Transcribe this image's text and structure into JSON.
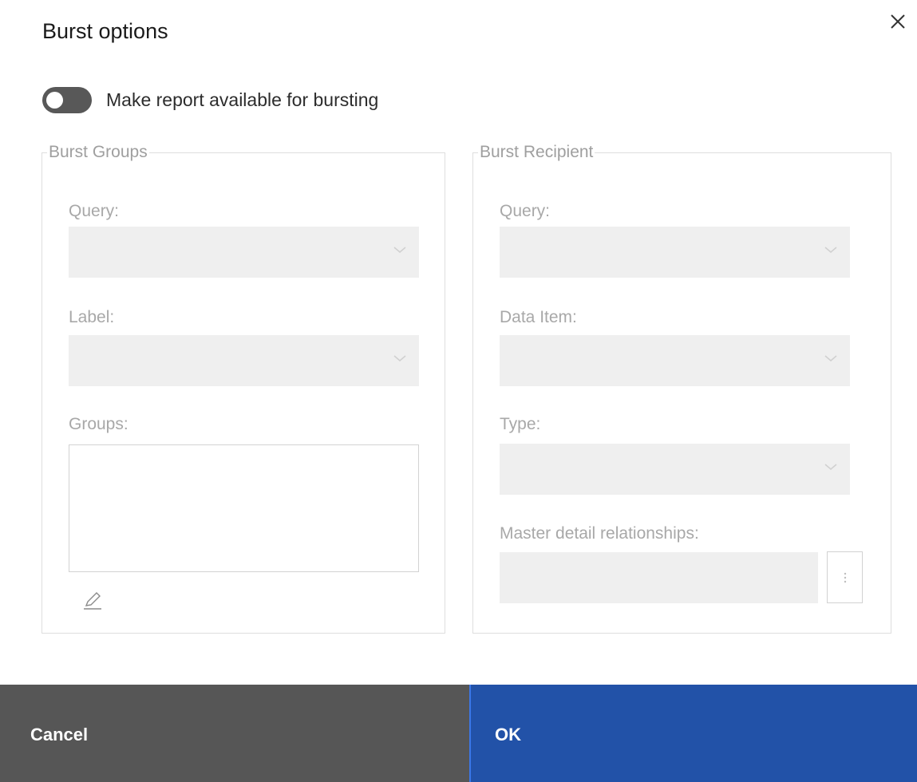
{
  "dialog": {
    "title": "Burst options",
    "close_icon": "close-icon"
  },
  "toggle": {
    "label": "Make report available for bursting",
    "state": "off"
  },
  "burst_groups": {
    "legend": "Burst Groups",
    "query_label": "Query:",
    "query_value": "",
    "label_label": "Label:",
    "label_value": "",
    "groups_label": "Groups:",
    "edit_icon": "pencil-icon"
  },
  "burst_recipient": {
    "legend": "Burst Recipient",
    "query_label": "Query:",
    "query_value": "",
    "data_item_label": "Data Item:",
    "data_item_value": "",
    "type_label": "Type:",
    "type_value": "",
    "master_detail_label": "Master detail relationships:",
    "master_detail_value": "",
    "more_icon": "more-vertical-icon"
  },
  "footer": {
    "cancel_label": "Cancel",
    "ok_label": "OK"
  },
  "colors": {
    "ok_bg": "#2252a8",
    "cancel_bg": "#565656",
    "toggle_off": "#585858"
  }
}
